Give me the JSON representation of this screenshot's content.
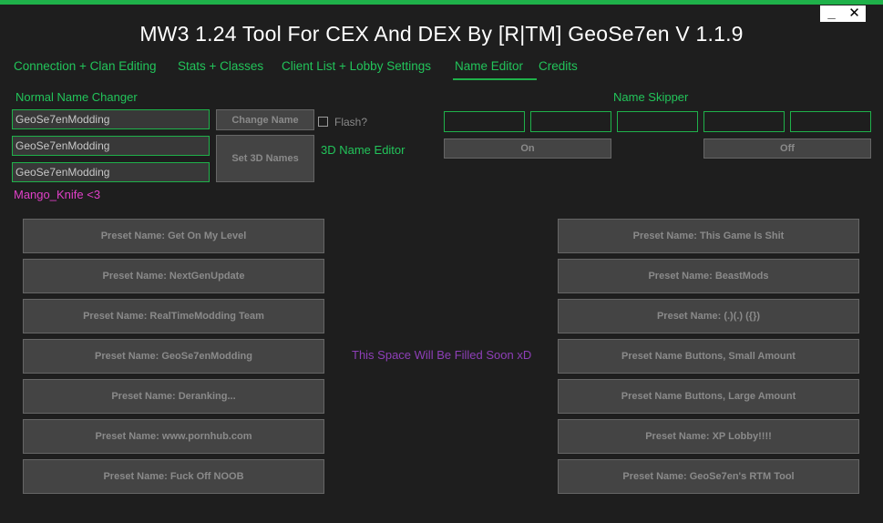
{
  "window": {
    "title": "MW3 1.24 Tool For CEX And DEX By [R|TM] GeoSe7en V 1.1.9",
    "minimize_label": "_",
    "close_label": "✕"
  },
  "tabs": [
    {
      "label": "Connection + Clan Editing"
    },
    {
      "label": "Stats + Classes"
    },
    {
      "label": "Client List + Lobby Settings"
    },
    {
      "label": "Name Editor"
    },
    {
      "label": "Credits"
    }
  ],
  "normal_name_changer": {
    "heading": "Normal Name Changer",
    "fields": [
      "GeoSe7enModding",
      "GeoSe7enModding",
      "GeoSe7enModding"
    ],
    "change_name_button": "Change Name",
    "flash_label": "Flash?",
    "set_3d_names_button": "Set 3D Names",
    "editor_label": "3D Name Editor",
    "credit_text": "Mango_Knife <3"
  },
  "name_skipper": {
    "heading": "Name Skipper",
    "fields": [
      "",
      "",
      "",
      "",
      ""
    ],
    "on_button": "On",
    "off_button": "Off"
  },
  "presets_left": [
    "Preset Name:  Get On My Level",
    "Preset Name: NextGenUpdate",
    "Preset Name: RealTimeModding Team",
    "Preset Name: GeoSe7enModding",
    "Preset Name: Deranking...",
    "Preset Name: www.pornhub.com",
    "Preset Name: Fuck Off NOOB"
  ],
  "presets_right": [
    "Preset Name:  This Game Is Shit",
    "Preset Name:  BeastMods",
    "Preset Name:  (.)(.) ({})",
    "Preset Name Buttons, Small Amount",
    "Preset Name Buttons, Large Amount",
    "Preset Name:  XP Lobby!!!!",
    "Preset Name: GeoSe7en's RTM Tool"
  ],
  "placeholder_text": "This Space Will Be Filled Soon xD",
  "colors": {
    "accent_green": "#1fb14a",
    "background": "#1e1e1e",
    "credit_pink": "#e040c8",
    "placeholder_purple": "#8e3fb8"
  }
}
